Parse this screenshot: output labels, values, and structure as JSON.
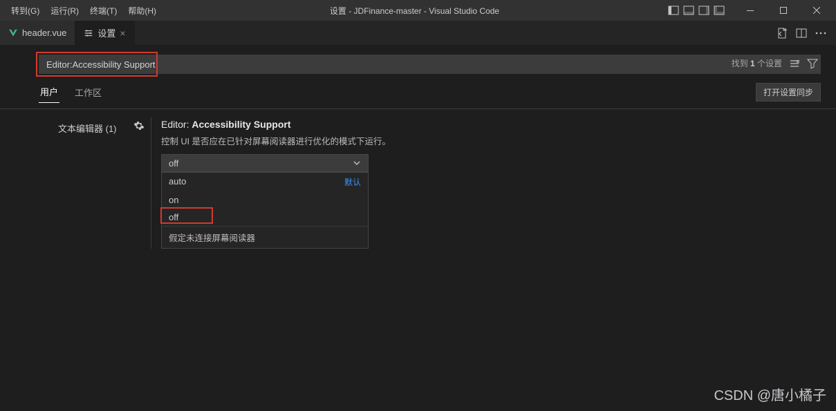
{
  "menu": {
    "goto": "转到(G)",
    "run": "运行(R)",
    "terminal": "终端(T)",
    "help": "帮助(H)"
  },
  "title": "设置 - JDFinance-master - Visual Studio Code",
  "tabs": {
    "file": {
      "label": "header.vue"
    },
    "settings": {
      "label": "设置"
    }
  },
  "search": {
    "value": "Editor:Accessibility Support",
    "result_prefix": "找到",
    "result_count": "1",
    "result_suffix": "个设置"
  },
  "scope": {
    "user": "用户",
    "workspace": "工作区",
    "sync": "打开设置同步"
  },
  "toc": {
    "text_editor": "文本编辑器 (1)"
  },
  "setting": {
    "prefix": "Editor: ",
    "name": "Accessibility Support",
    "desc": "控制 UI 是否应在已针对屏幕阅读器进行优化的模式下运行。",
    "value": "off",
    "options": {
      "auto": {
        "label": "auto",
        "default_tag": "默认"
      },
      "on": {
        "label": "on"
      },
      "off": {
        "label": "off"
      }
    },
    "option_desc": "假定未连接屏幕阅读器"
  },
  "watermark": "CSDN @唐小橘子"
}
